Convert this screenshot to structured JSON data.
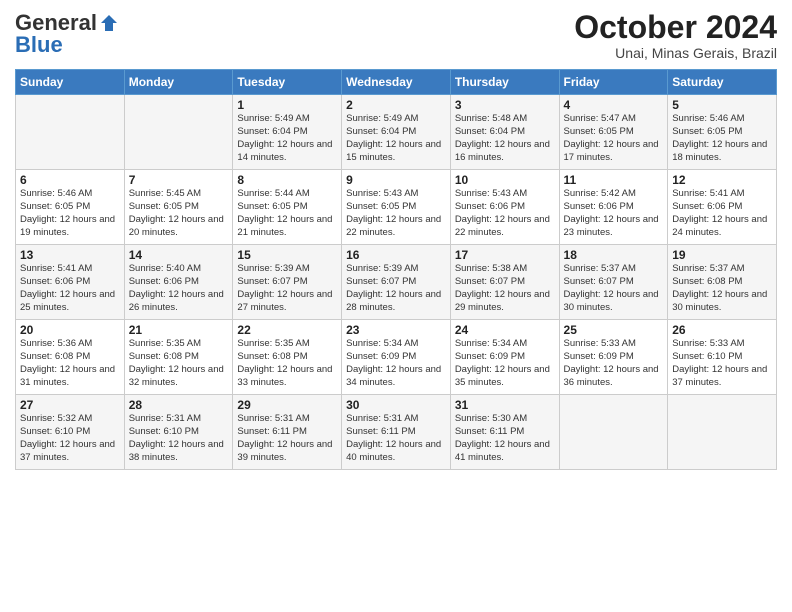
{
  "header": {
    "logo_general": "General",
    "logo_blue": "Blue",
    "month_title": "October 2024",
    "location": "Unai, Minas Gerais, Brazil"
  },
  "weekdays": [
    "Sunday",
    "Monday",
    "Tuesday",
    "Wednesday",
    "Thursday",
    "Friday",
    "Saturday"
  ],
  "weeks": [
    [
      {
        "day": "",
        "sunrise": "",
        "sunset": "",
        "daylight": ""
      },
      {
        "day": "",
        "sunrise": "",
        "sunset": "",
        "daylight": ""
      },
      {
        "day": "1",
        "sunrise": "Sunrise: 5:49 AM",
        "sunset": "Sunset: 6:04 PM",
        "daylight": "Daylight: 12 hours and 14 minutes."
      },
      {
        "day": "2",
        "sunrise": "Sunrise: 5:49 AM",
        "sunset": "Sunset: 6:04 PM",
        "daylight": "Daylight: 12 hours and 15 minutes."
      },
      {
        "day": "3",
        "sunrise": "Sunrise: 5:48 AM",
        "sunset": "Sunset: 6:04 PM",
        "daylight": "Daylight: 12 hours and 16 minutes."
      },
      {
        "day": "4",
        "sunrise": "Sunrise: 5:47 AM",
        "sunset": "Sunset: 6:05 PM",
        "daylight": "Daylight: 12 hours and 17 minutes."
      },
      {
        "day": "5",
        "sunrise": "Sunrise: 5:46 AM",
        "sunset": "Sunset: 6:05 PM",
        "daylight": "Daylight: 12 hours and 18 minutes."
      }
    ],
    [
      {
        "day": "6",
        "sunrise": "Sunrise: 5:46 AM",
        "sunset": "Sunset: 6:05 PM",
        "daylight": "Daylight: 12 hours and 19 minutes."
      },
      {
        "day": "7",
        "sunrise": "Sunrise: 5:45 AM",
        "sunset": "Sunset: 6:05 PM",
        "daylight": "Daylight: 12 hours and 20 minutes."
      },
      {
        "day": "8",
        "sunrise": "Sunrise: 5:44 AM",
        "sunset": "Sunset: 6:05 PM",
        "daylight": "Daylight: 12 hours and 21 minutes."
      },
      {
        "day": "9",
        "sunrise": "Sunrise: 5:43 AM",
        "sunset": "Sunset: 6:05 PM",
        "daylight": "Daylight: 12 hours and 22 minutes."
      },
      {
        "day": "10",
        "sunrise": "Sunrise: 5:43 AM",
        "sunset": "Sunset: 6:06 PM",
        "daylight": "Daylight: 12 hours and 22 minutes."
      },
      {
        "day": "11",
        "sunrise": "Sunrise: 5:42 AM",
        "sunset": "Sunset: 6:06 PM",
        "daylight": "Daylight: 12 hours and 23 minutes."
      },
      {
        "day": "12",
        "sunrise": "Sunrise: 5:41 AM",
        "sunset": "Sunset: 6:06 PM",
        "daylight": "Daylight: 12 hours and 24 minutes."
      }
    ],
    [
      {
        "day": "13",
        "sunrise": "Sunrise: 5:41 AM",
        "sunset": "Sunset: 6:06 PM",
        "daylight": "Daylight: 12 hours and 25 minutes."
      },
      {
        "day": "14",
        "sunrise": "Sunrise: 5:40 AM",
        "sunset": "Sunset: 6:06 PM",
        "daylight": "Daylight: 12 hours and 26 minutes."
      },
      {
        "day": "15",
        "sunrise": "Sunrise: 5:39 AM",
        "sunset": "Sunset: 6:07 PM",
        "daylight": "Daylight: 12 hours and 27 minutes."
      },
      {
        "day": "16",
        "sunrise": "Sunrise: 5:39 AM",
        "sunset": "Sunset: 6:07 PM",
        "daylight": "Daylight: 12 hours and 28 minutes."
      },
      {
        "day": "17",
        "sunrise": "Sunrise: 5:38 AM",
        "sunset": "Sunset: 6:07 PM",
        "daylight": "Daylight: 12 hours and 29 minutes."
      },
      {
        "day": "18",
        "sunrise": "Sunrise: 5:37 AM",
        "sunset": "Sunset: 6:07 PM",
        "daylight": "Daylight: 12 hours and 30 minutes."
      },
      {
        "day": "19",
        "sunrise": "Sunrise: 5:37 AM",
        "sunset": "Sunset: 6:08 PM",
        "daylight": "Daylight: 12 hours and 30 minutes."
      }
    ],
    [
      {
        "day": "20",
        "sunrise": "Sunrise: 5:36 AM",
        "sunset": "Sunset: 6:08 PM",
        "daylight": "Daylight: 12 hours and 31 minutes."
      },
      {
        "day": "21",
        "sunrise": "Sunrise: 5:35 AM",
        "sunset": "Sunset: 6:08 PM",
        "daylight": "Daylight: 12 hours and 32 minutes."
      },
      {
        "day": "22",
        "sunrise": "Sunrise: 5:35 AM",
        "sunset": "Sunset: 6:08 PM",
        "daylight": "Daylight: 12 hours and 33 minutes."
      },
      {
        "day": "23",
        "sunrise": "Sunrise: 5:34 AM",
        "sunset": "Sunset: 6:09 PM",
        "daylight": "Daylight: 12 hours and 34 minutes."
      },
      {
        "day": "24",
        "sunrise": "Sunrise: 5:34 AM",
        "sunset": "Sunset: 6:09 PM",
        "daylight": "Daylight: 12 hours and 35 minutes."
      },
      {
        "day": "25",
        "sunrise": "Sunrise: 5:33 AM",
        "sunset": "Sunset: 6:09 PM",
        "daylight": "Daylight: 12 hours and 36 minutes."
      },
      {
        "day": "26",
        "sunrise": "Sunrise: 5:33 AM",
        "sunset": "Sunset: 6:10 PM",
        "daylight": "Daylight: 12 hours and 37 minutes."
      }
    ],
    [
      {
        "day": "27",
        "sunrise": "Sunrise: 5:32 AM",
        "sunset": "Sunset: 6:10 PM",
        "daylight": "Daylight: 12 hours and 37 minutes."
      },
      {
        "day": "28",
        "sunrise": "Sunrise: 5:31 AM",
        "sunset": "Sunset: 6:10 PM",
        "daylight": "Daylight: 12 hours and 38 minutes."
      },
      {
        "day": "29",
        "sunrise": "Sunrise: 5:31 AM",
        "sunset": "Sunset: 6:11 PM",
        "daylight": "Daylight: 12 hours and 39 minutes."
      },
      {
        "day": "30",
        "sunrise": "Sunrise: 5:31 AM",
        "sunset": "Sunset: 6:11 PM",
        "daylight": "Daylight: 12 hours and 40 minutes."
      },
      {
        "day": "31",
        "sunrise": "Sunrise: 5:30 AM",
        "sunset": "Sunset: 6:11 PM",
        "daylight": "Daylight: 12 hours and 41 minutes."
      },
      {
        "day": "",
        "sunrise": "",
        "sunset": "",
        "daylight": ""
      },
      {
        "day": "",
        "sunrise": "",
        "sunset": "",
        "daylight": ""
      }
    ]
  ]
}
